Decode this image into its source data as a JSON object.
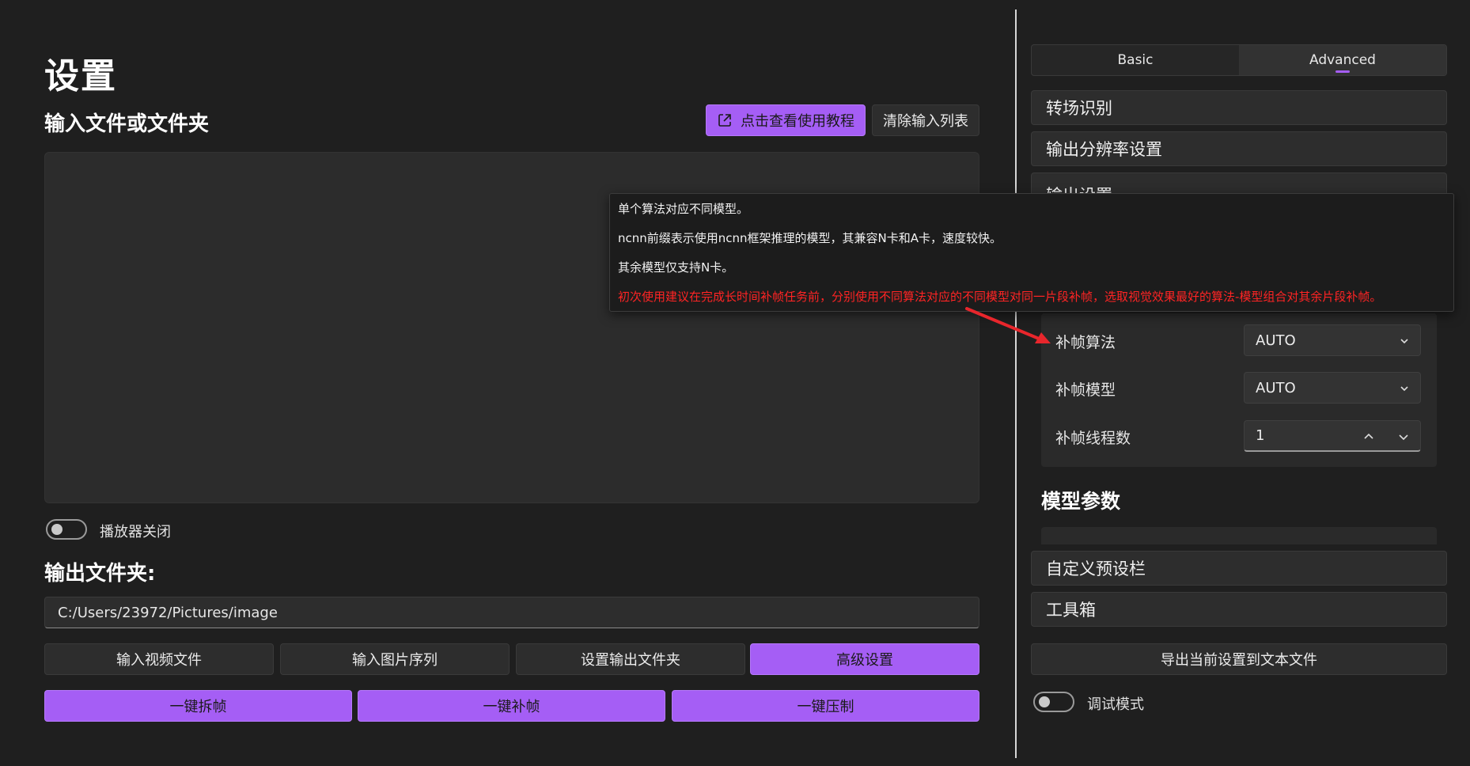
{
  "page": {
    "title": "设置"
  },
  "input_section": {
    "title": "输入文件或文件夹",
    "tutorial_label": "点击查看使用教程",
    "clear_label": "清除输入列表"
  },
  "player": {
    "toggle_label": "播放器关闭",
    "enabled": false
  },
  "output_section": {
    "title": "输出文件夹:",
    "path_value": "C:/Users/23972/Pictures/image"
  },
  "action_buttons": {
    "input_video": "输入视频文件",
    "input_images": "输入图片序列",
    "set_output": "设置输出文件夹",
    "advanced": "高级设置",
    "extract": "一键拆帧",
    "interpolate": "一键补帧",
    "compress": "一键压制"
  },
  "tabs": [
    {
      "label": "Basic",
      "active": false
    },
    {
      "label": "Advanced",
      "active": true
    }
  ],
  "expanders": {
    "scene": "转场识别",
    "resolution": "输出分辨率设置",
    "output": "输出设置",
    "preset": "自定义预设栏",
    "toolbox": "工具箱"
  },
  "interpolation": {
    "algorithm_label": "补帧算法",
    "algorithm_value": "AUTO",
    "model_label": "补帧模型",
    "model_value": "AUTO",
    "threads_label": "补帧线程数",
    "threads_value": "1"
  },
  "model_params": {
    "title": "模型参数"
  },
  "export_label": "导出当前设置到文本文件",
  "debug": {
    "label": "调试模式",
    "enabled": false
  },
  "tooltip": {
    "lines": [
      "单个算法对应不同模型。",
      "ncnn前缀表示使用ncnn框架推理的模型，其兼容N卡和A卡，速度较快。",
      "其余模型仅支持N卡。"
    ],
    "warning": "初次使用建议在完成长时间补帧任务前，分别使用不同算法对应的不同模型对同一片段补帧，选取视觉效果最好的算法-模型组合对其余片段补帧。"
  },
  "colors": {
    "accent": "#a55ef5",
    "background": "#1f1f1f",
    "warning_text": "#ff2424",
    "annotation_arrow": "#e8262c"
  },
  "icons": {
    "tutorial": "external-link-icon",
    "combo": "chevron-down-icon",
    "spin_up": "chevron-up-icon",
    "spin_down": "chevron-down-icon"
  }
}
